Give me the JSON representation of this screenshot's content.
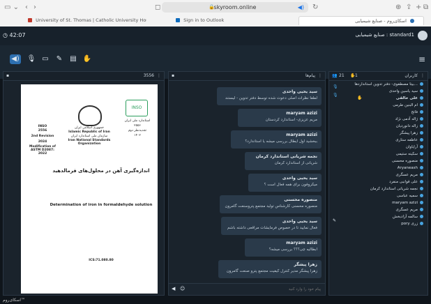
{
  "browser": {
    "url": "skyroom.online",
    "tabs": [
      {
        "label": "University of St. Thomas | Catholic University Houston, Tx",
        "icon": "red"
      },
      {
        "label": "Sign in to Outlook",
        "icon": "blue"
      },
      {
        "label": "اسکای‌روم - صنایع شیمیایی",
        "icon": "skyroom"
      }
    ]
  },
  "app": {
    "timer": "42:07",
    "room_title": "صنایع شیمیایی : standard1",
    "accent": "#47a3e0"
  },
  "document_panel": {
    "page_count": "3556",
    "doc": {
      "iran_national_standard": "استاندارد ملی ایران",
      "standard_no": "۲۵۵۶",
      "revision": "تجدیدنظر دوم",
      "year": "۱۴۰۲",
      "header_fa1": "جمهوری اسلامی ایران",
      "header_en1": "Islamic Republic of Iran",
      "header_fa2": "سازمان ملی استاندارد ایران",
      "header_en2": "Iran National Standards Organization",
      "inso": "INSO",
      "inso_no": "2556",
      "rev_en": "2nd Revision",
      "year_en": "2024",
      "modification": "Modification of ASTM D2087: 2022",
      "title_fa": "اندازه‌گیری آهن در محلول‌های فرمالدهید",
      "title_en": "Determination of iron in formaldehyde solution",
      "ics": "ICS:71.080.80"
    }
  },
  "chat": {
    "title": "پیام‌ها",
    "input_placeholder": "پیام خود را وارد کنید",
    "messages": [
      {
        "name": "سید یحیی واحدی",
        "text": "لطفا نظرات اصلی دعوت شده توسط دفتر تدوین - لیستند"
      },
      {
        "name": "maryam azizi",
        "text": "مریم عزیزی- استاندارد کردستان"
      },
      {
        "name": "maryam azizi",
        "text": "ببخشید اول ایطال بررسی میشه یا استاندارد؟"
      },
      {
        "name": "نجمه شریانی استاندارد کرمان",
        "text": "شریانی از استاندارد کرمان"
      },
      {
        "name": "سید یحیی واحدی",
        "text": "میکروفون برای همه فعال است ؟"
      },
      {
        "name": "منصوره محسنی",
        "text": "منصوره محسنی کارشناس تولید مجتمع پتروسنعت گامرون"
      },
      {
        "name": "سید یحیی واحدی",
        "text": "فعال نمایید تا در خصوص فرمایشات مراقعی داشته باشم"
      },
      {
        "name": "maryam azizi",
        "text": "ابطالیه چی؟؟؟ بررسی میشه؟"
      },
      {
        "name": "زهرا پیشگر",
        "text": "زهرا پیشگر مدیر کنترل کیفیت مجتمع پترو صنعت گامرون"
      }
    ]
  },
  "users_panel": {
    "title": "کاربران",
    "count_people": "21",
    "count_mic": "1",
    "users": [
      "بیتا مصطفوی- دفتر تدوین استانداردها...",
      "سید یاسین واحدی",
      "علی خالقی",
      "ام البنین طرمی",
      "فاتح",
      "ژاله آدمی نژاد",
      "زاله دانوردیان",
      "زهرا پیشگر",
      "عاطفه ستاری",
      "آرایاوان",
      "سکینه ستیمی",
      "منصوره محسنی",
      "Aryaneash",
      "مریم عسگری",
      "علی قوانبی منفرد",
      "نجمه شریانی استاندارد کرمان",
      "سمیه عباسی",
      "maryam azizi",
      "مریم عسگری",
      "سالمه آزادبخش",
      "pory زری"
    ]
  },
  "footer": {
    "label": "اسکای‌روم™"
  }
}
